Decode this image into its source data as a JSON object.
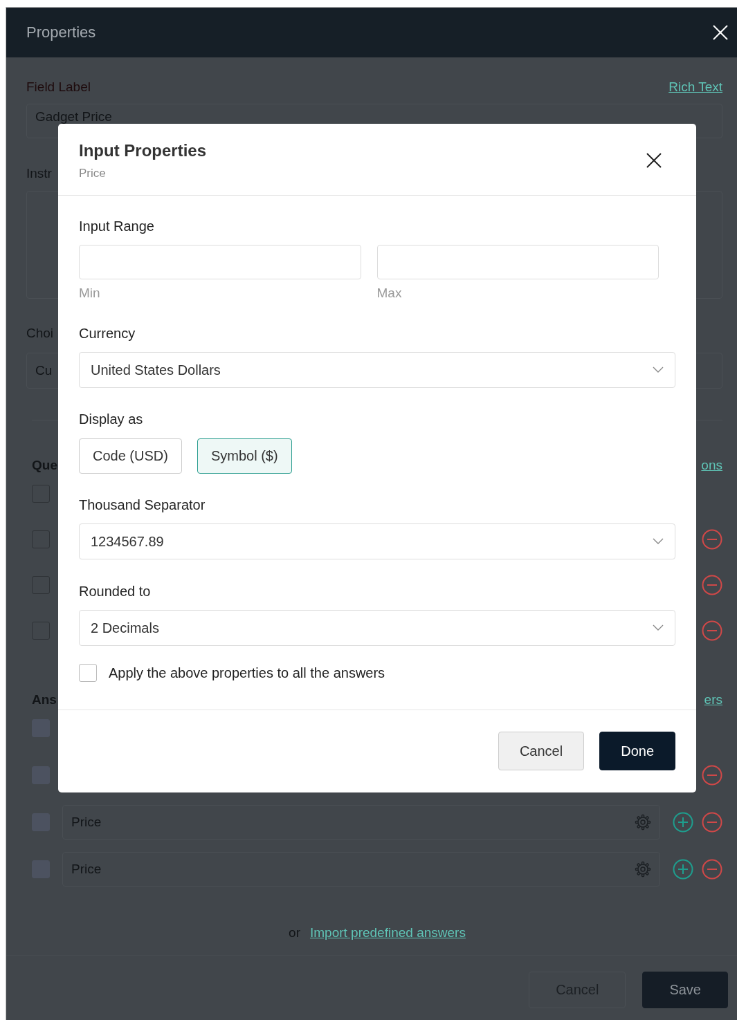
{
  "window": {
    "title": "Properties"
  },
  "background": {
    "field_label": "Field Label",
    "rich_text_link": "Rich Text",
    "field_value": "Gadget Price",
    "instructions_label": "Instr",
    "choices_label": "Choi",
    "choices_value": "Cu",
    "questions_label": "Que",
    "questions_link": "ons",
    "question_rows": [
      {
        "kind": "checkbox",
        "checked": false
      },
      {
        "kind": "removable",
        "checked": false
      },
      {
        "kind": "removable",
        "checked": false
      },
      {
        "kind": "removable",
        "checked": false
      }
    ],
    "answers_label": "Ans",
    "answers_link": "ers",
    "answer_rows": [
      {
        "kind": "checkbox",
        "checked": false
      },
      {
        "kind": "removable",
        "checked": false
      },
      {
        "kind": "full",
        "checked": false,
        "value": "Price"
      },
      {
        "kind": "full",
        "checked": false,
        "value": "Price"
      }
    ],
    "import_prefix": "or",
    "import_link": "Import predefined answers",
    "buttons": [
      {
        "label": "Cancel",
        "kind": "secondary"
      },
      {
        "label": "Save",
        "kind": "primary"
      }
    ]
  },
  "dialog": {
    "title": "Input Properties",
    "subtitle": "Price",
    "input_range": {
      "label": "Input Range",
      "min_caption": "Min",
      "max_caption": "Max"
    },
    "currency": {
      "label": "Currency",
      "value": "United States Dollars"
    },
    "display_as": {
      "label": "Display as",
      "options": [
        {
          "label": "Code (USD)",
          "selected": false
        },
        {
          "label": "Symbol ($)",
          "selected": true
        }
      ]
    },
    "thousand_separator": {
      "label": "Thousand Separator",
      "value": "1234567.89"
    },
    "rounded_to": {
      "label": "Rounded to",
      "value": "2 Decimals"
    },
    "apply_all": {
      "label": "Apply the above properties to all the answers",
      "checked": false
    },
    "buttons": [
      {
        "label": "Cancel",
        "kind": "secondary"
      },
      {
        "label": "Done",
        "kind": "primary"
      }
    ]
  }
}
